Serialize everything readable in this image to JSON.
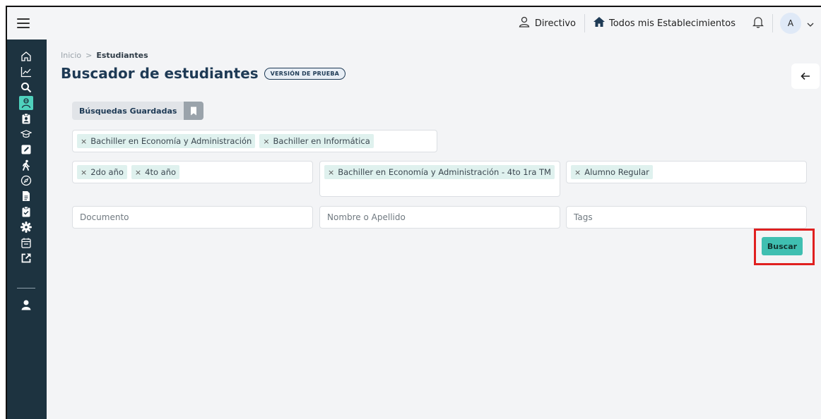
{
  "topbar": {
    "role_label": "Directivo",
    "establishments_label": "Todos mis Establecimientos",
    "avatar_initial": "A"
  },
  "breadcrumb": {
    "home": "Inicio",
    "separator": ">",
    "current": "Estudiantes"
  },
  "page": {
    "title": "Buscador de estudiantes",
    "badge": "VERSIÓN DE PRUEBA"
  },
  "saved_searches": {
    "label": "Búsquedas Guardadas"
  },
  "filters": {
    "careers": [
      "Bachiller en Economía y Administración",
      "Bachiller en Informática"
    ],
    "years": [
      "2do año",
      "4to año"
    ],
    "courses": [
      "Bachiller en Economía y Administración - 4to 1ra TM"
    ],
    "status": [
      "Alumno Regular"
    ]
  },
  "inputs": {
    "document_placeholder": "Documento",
    "name_placeholder": "Nombre o Apellido",
    "tags_placeholder": "Tags"
  },
  "actions": {
    "search_label": "Buscar"
  },
  "chip_remove_symbol": "×",
  "colors": {
    "sidebar": "#1d3340",
    "accent": "#3fbfb1",
    "chip_bg": "#dff1ee",
    "title": "#1e3a55",
    "highlight": "#e02020"
  },
  "sidebar_icons": [
    "home-icon",
    "chart-icon",
    "search-icon",
    "students-icon",
    "clipboard-user-icon",
    "graduation-cap-icon",
    "edit-icon",
    "walking-icon",
    "compass-icon",
    "document-icon",
    "clipboard-check-icon",
    "gear-icon",
    "calendar-icon",
    "external-link-icon",
    "user-icon"
  ]
}
